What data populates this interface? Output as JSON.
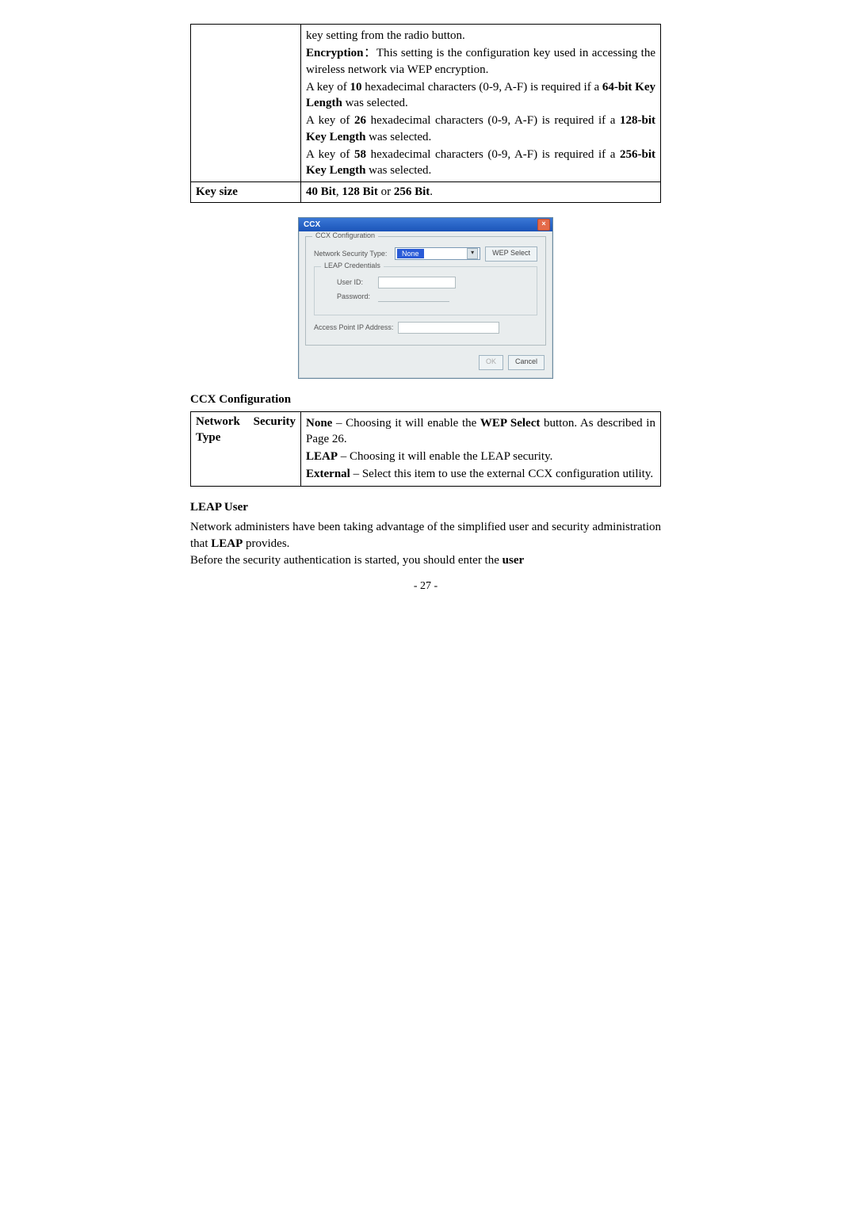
{
  "table1": {
    "row1": {
      "label": "",
      "p1_pre": "key setting from the radio button.",
      "p2_b": "Encryption",
      "p2_sep": "：",
      "p2_rest": "This setting is the configuration key used in accessing the wireless network via WEP encryption.",
      "p3_a": "A key of ",
      "p3_b": "10",
      "p3_c": " hexadecimal characters (0-9, A-F) is required if a ",
      "p3_d": "64-bit Key Length",
      "p3_e": " was selected.",
      "p4_a": "A key of ",
      "p4_b": "26",
      "p4_c": " hexadecimal characters (0-9, A-F) is required if a ",
      "p4_d": "128-bit Key Length",
      "p4_e": " was selected.",
      "p5_a": "A key of ",
      "p5_b": "58",
      "p5_c": " hexadecimal characters (0-9, A-F) is required if a ",
      "p5_d": "256-bit Key Length",
      "p5_e": " was selected."
    },
    "row2": {
      "label": "Key size",
      "v_a": "40 Bit",
      "v_sep1": ", ",
      "v_b": "128 Bit",
      "v_sep2": " or ",
      "v_c": "256 Bit",
      "v_end": "."
    }
  },
  "dialog": {
    "title": "CCX",
    "group": "CCX Configuration",
    "nst_label": "Network Security Type:",
    "nst_value": "None",
    "wep_btn": "WEP Select",
    "leap_group": "LEAP Credentials",
    "userid_label": "User ID:",
    "userid_placeholder": "",
    "pw_label": "Password:",
    "ap_label": "Access Point IP Address:",
    "ok": "OK",
    "cancel": "Cancel"
  },
  "section1": "CCX Configuration",
  "table2": {
    "label": "Network Security Type",
    "p1_b": "None",
    "p1_mid": " – Choosing it will enable the ",
    "p1_b2": "WEP Select",
    "p1_rest": " button. As described in Page 26.",
    "p2_b": "LEAP",
    "p2_mid": " – Choosing it will enable the LEAP security.",
    "p3_b": "External",
    "p3_rest": " – Select this item to use the external CCX configuration utility."
  },
  "leap": {
    "title": "LEAP User",
    "p1_a": "Network administers have been taking advantage of the simplified user and security administration that ",
    "p1_b": "LEAP",
    "p1_c": " provides.",
    "p2_a": "Before the security authentication is started, you should enter the ",
    "p2_b": "user"
  },
  "page_number": "- 27 -"
}
